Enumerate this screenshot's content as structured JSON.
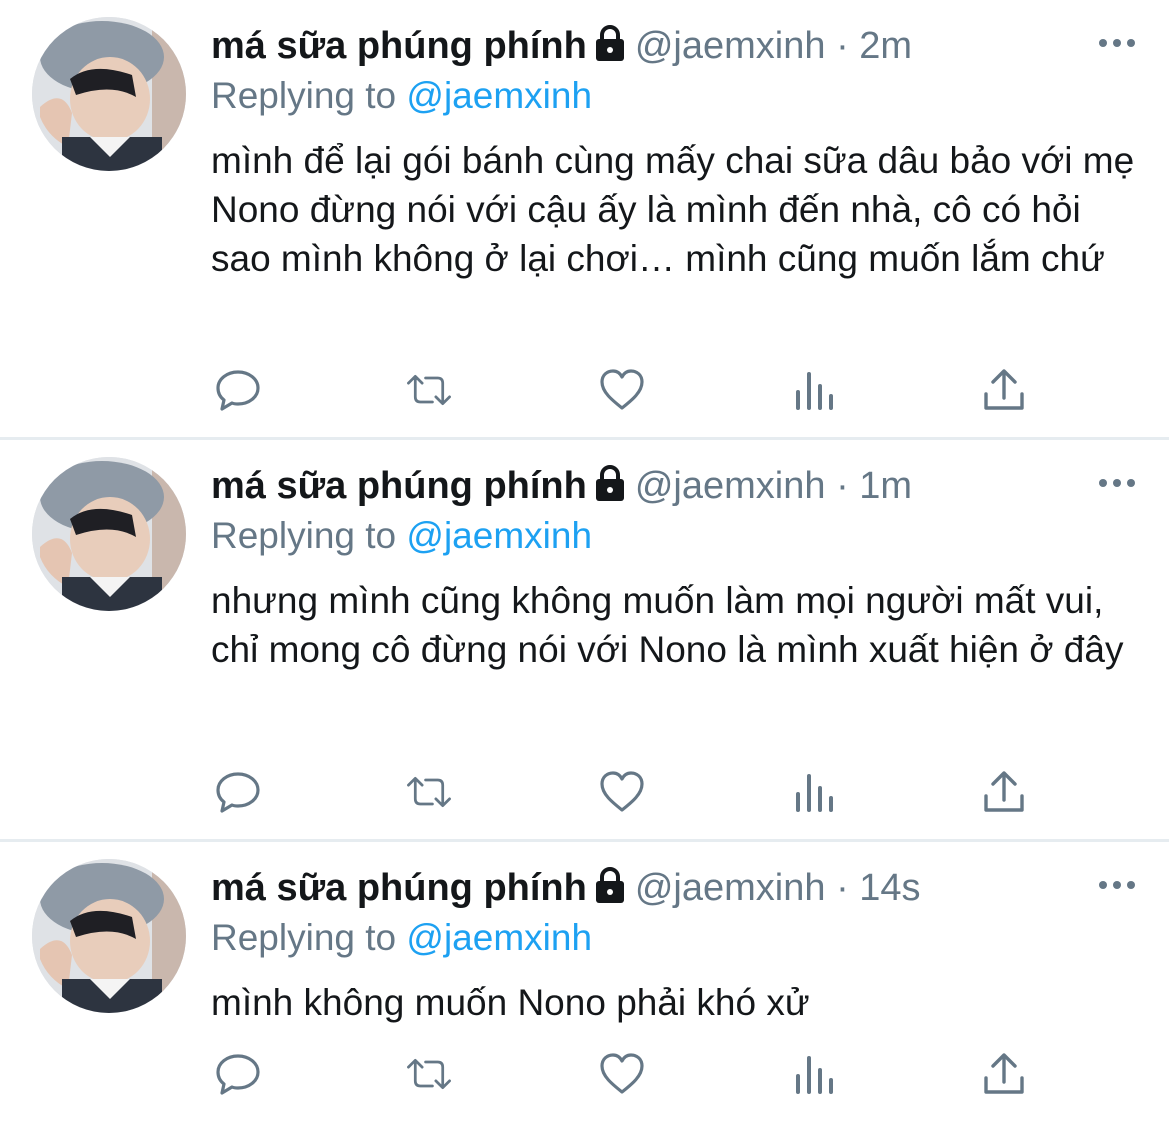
{
  "tweets": [
    {
      "name": "má sữa phúng phính",
      "handle": "@jaemxinh",
      "separator": "·",
      "time": "2m",
      "replying_prefix": "Replying to",
      "replying_to": "@jaemxinh",
      "text": "mình để lại gói bánh cùng mấy chai sữa dâu bảo với mẹ Nono đừng nói với cậu ấy là mình đến nhà, cô có hỏi sao mình không ở lại chơi… mình cũng muốn lắm chứ"
    },
    {
      "name": "má sữa phúng phính",
      "handle": "@jaemxinh",
      "separator": "·",
      "time": "1m",
      "replying_prefix": "Replying to",
      "replying_to": "@jaemxinh",
      "text": "nhưng mình cũng không muốn làm mọi người mất vui, chỉ mong cô đừng nói với Nono là mình xuất hiện ở đây"
    },
    {
      "name": "má sữa phúng phính",
      "handle": "@jaemxinh",
      "separator": "·",
      "time": "14s",
      "replying_prefix": "Replying to",
      "replying_to": "@jaemxinh",
      "text": "mình không muốn Nono phải khó xử"
    }
  ],
  "icons": {
    "reply": "comment-icon",
    "retweet": "retweet-icon",
    "like": "heart-icon",
    "analytics": "analytics-icon",
    "share": "share-icon",
    "more": "more-dots-icon",
    "lock": "lock-icon"
  },
  "colors": {
    "text": "#14171a",
    "secondary": "#657786",
    "mention": "#1da1f2",
    "divider": "#e6ecf0"
  }
}
